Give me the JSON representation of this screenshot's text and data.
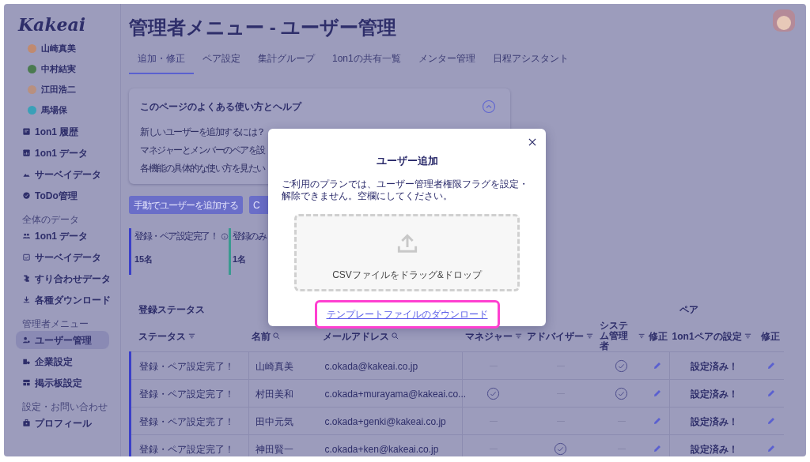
{
  "logo": "Kakeai",
  "sidebar": {
    "members": [
      {
        "name": "山崎真美"
      },
      {
        "name": "中村結実"
      },
      {
        "name": "江田浩二"
      },
      {
        "name": "馬場保"
      }
    ],
    "sections": [
      {
        "items": [
          {
            "label": "1on1 履歴",
            "selected": false
          },
          {
            "label": "1on1 データ",
            "selected": false
          },
          {
            "label": "サーベイデータ",
            "selected": false
          },
          {
            "label": "ToDo管理",
            "selected": false
          }
        ]
      },
      {
        "title": "全体のデータ",
        "items": [
          {
            "label": "1on1 データ",
            "selected": false
          },
          {
            "label": "サーベイデータ",
            "selected": false
          },
          {
            "label": "すり合わせデータ",
            "selected": false
          },
          {
            "label": "各種ダウンロード",
            "selected": false
          }
        ]
      },
      {
        "title": "管理者メニュー",
        "items": [
          {
            "label": "ユーザー管理",
            "selected": true
          },
          {
            "label": "企業設定",
            "selected": false
          },
          {
            "label": "掲示板設定",
            "selected": false
          }
        ]
      },
      {
        "title": "設定・お問い合わせ",
        "items": [
          {
            "label": "プロフィール",
            "selected": false
          }
        ]
      }
    ]
  },
  "page_title": "管理者メニュー - ユーザー管理",
  "tabs": [
    {
      "label": "追加・修正",
      "selected": true
    },
    {
      "label": "ペア設定",
      "selected": false
    },
    {
      "label": "集計グループ",
      "selected": false
    },
    {
      "label": "1on1の共有一覧",
      "selected": false
    },
    {
      "label": "メンター管理",
      "selected": false
    },
    {
      "label": "日程アシスタント",
      "selected": false
    }
  ],
  "help": {
    "title": "このページのよくある使い方とヘルプ",
    "expanded": true,
    "lines": [
      "新しいユーザーを追加するには？",
      "マネジャーとメンバーのペアを設",
      "各機能の具体的な使い方を見たい"
    ]
  },
  "buttons": [
    "手動でユーザーを追加する",
    "C"
  ],
  "stats": [
    {
      "label": "登録・ペア設定完了！",
      "value": "15名",
      "color": "#3a3fc8",
      "info": true
    },
    {
      "label": "登録のみ",
      "value": "1名",
      "color": "#3a9a90"
    }
  ],
  "table": {
    "groups": [
      {
        "label": "登録ステータス"
      },
      {
        "label": "ペア"
      }
    ],
    "columns": [
      {
        "label": "ステータス",
        "kind": "filter"
      },
      {
        "label": "名前",
        "kind": "search"
      },
      {
        "label": "メールアドレス",
        "kind": "search"
      },
      {
        "label": "マネジャー",
        "kind": "filter"
      },
      {
        "label": "アドバイザー",
        "kind": "filter"
      },
      {
        "label": "システム管理者",
        "kind": "filter"
      },
      {
        "label": "修正",
        "kind": "plain"
      },
      {
        "label": "1on1ペアの設定",
        "kind": "filter"
      },
      {
        "label": "修正",
        "kind": "plain"
      }
    ],
    "rows": [
      {
        "status": "登録・ペア設定完了！",
        "name": "山崎真美",
        "email": "c.okada@kakeai.co.jp",
        "manager": false,
        "advisor": false,
        "sysadmin": true,
        "pair": "設定済み！"
      },
      {
        "status": "登録・ペア設定完了！",
        "name": "村田美和",
        "email": "c.okada+murayama@kakeai.co...",
        "manager": true,
        "advisor": false,
        "sysadmin": true,
        "pair": "設定済み！"
      },
      {
        "status": "登録・ペア設定完了！",
        "name": "田中元気",
        "email": "c.okada+genki@kakeai.co.jp",
        "manager": false,
        "advisor": false,
        "sysadmin": false,
        "pair": "設定済み！"
      },
      {
        "status": "登録・ペア設定完了！",
        "name": "神田賢一",
        "email": "c.okada+ken@kakeai.co.jp",
        "manager": false,
        "advisor": true,
        "sysadmin": false,
        "pair": "設定済み！"
      }
    ]
  },
  "modal": {
    "title": "ユーザー追加",
    "message": "ご利用のプランでは、ユーザー管理者権限フラグを設定・解除できません。空欄にしてください。",
    "dropzone_text": "CSVファイルをドラッグ&ドロップ",
    "template_link": "テンプレートファイルのダウンロード",
    "highlighted": true
  }
}
